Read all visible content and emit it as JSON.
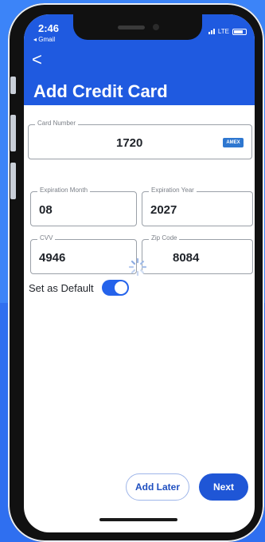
{
  "status_bar": {
    "time": "2:46",
    "carrier": "◂ Gmail",
    "network": "LTE"
  },
  "nav": {
    "back_icon": "chevron-left-icon",
    "back_glyph": "<"
  },
  "page": {
    "title": "Add Credit Card"
  },
  "form": {
    "card_number": {
      "label": "Card Number",
      "value": "1720",
      "brand": "AMEX"
    },
    "expiration_month": {
      "label": "Expiration Month",
      "value": "08"
    },
    "expiration_year": {
      "label": "Expiration Year",
      "value": "2027"
    },
    "cvv": {
      "label": "CVV",
      "value": "4946"
    },
    "zip_code": {
      "label": "Zip Code",
      "value": "8084"
    }
  },
  "default_toggle": {
    "label": "Set as Default",
    "on": true
  },
  "actions": {
    "add_later_label": "Add Later",
    "next_label": "Next"
  },
  "colors": {
    "header": "#1f5ae0",
    "accent": "#1f56d6",
    "toggle_on": "#2563eb"
  }
}
